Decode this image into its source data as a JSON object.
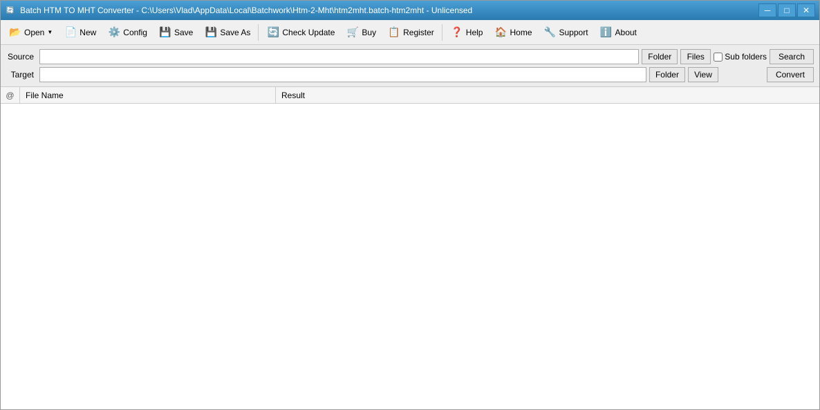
{
  "window": {
    "title": "Batch HTM TO MHT Converter - C:\\Users\\Vlad\\AppData\\Local\\Batchwork\\Htm-2-Mht\\htm2mht.batch-htm2mht - Unlicensed",
    "icon": "🔄"
  },
  "titlebar": {
    "minimize_label": "─",
    "maximize_label": "□",
    "close_label": "✕"
  },
  "toolbar": {
    "open_label": "Open",
    "new_label": "New",
    "config_label": "Config",
    "save_label": "Save",
    "saveas_label": "Save As",
    "checkupdate_label": "Check Update",
    "buy_label": "Buy",
    "register_label": "Register",
    "help_label": "Help",
    "home_label": "Home",
    "support_label": "Support",
    "about_label": "About"
  },
  "form": {
    "source_label": "Source",
    "target_label": "Target",
    "source_value": "",
    "target_value": "",
    "folder_label": "Folder",
    "files_label": "Files",
    "view_label": "View",
    "subfolders_label": "Sub folders",
    "search_label": "Search",
    "convert_label": "Convert"
  },
  "table": {
    "col_icon_label": "@",
    "col_filename_label": "File Name",
    "col_result_label": "Result"
  }
}
